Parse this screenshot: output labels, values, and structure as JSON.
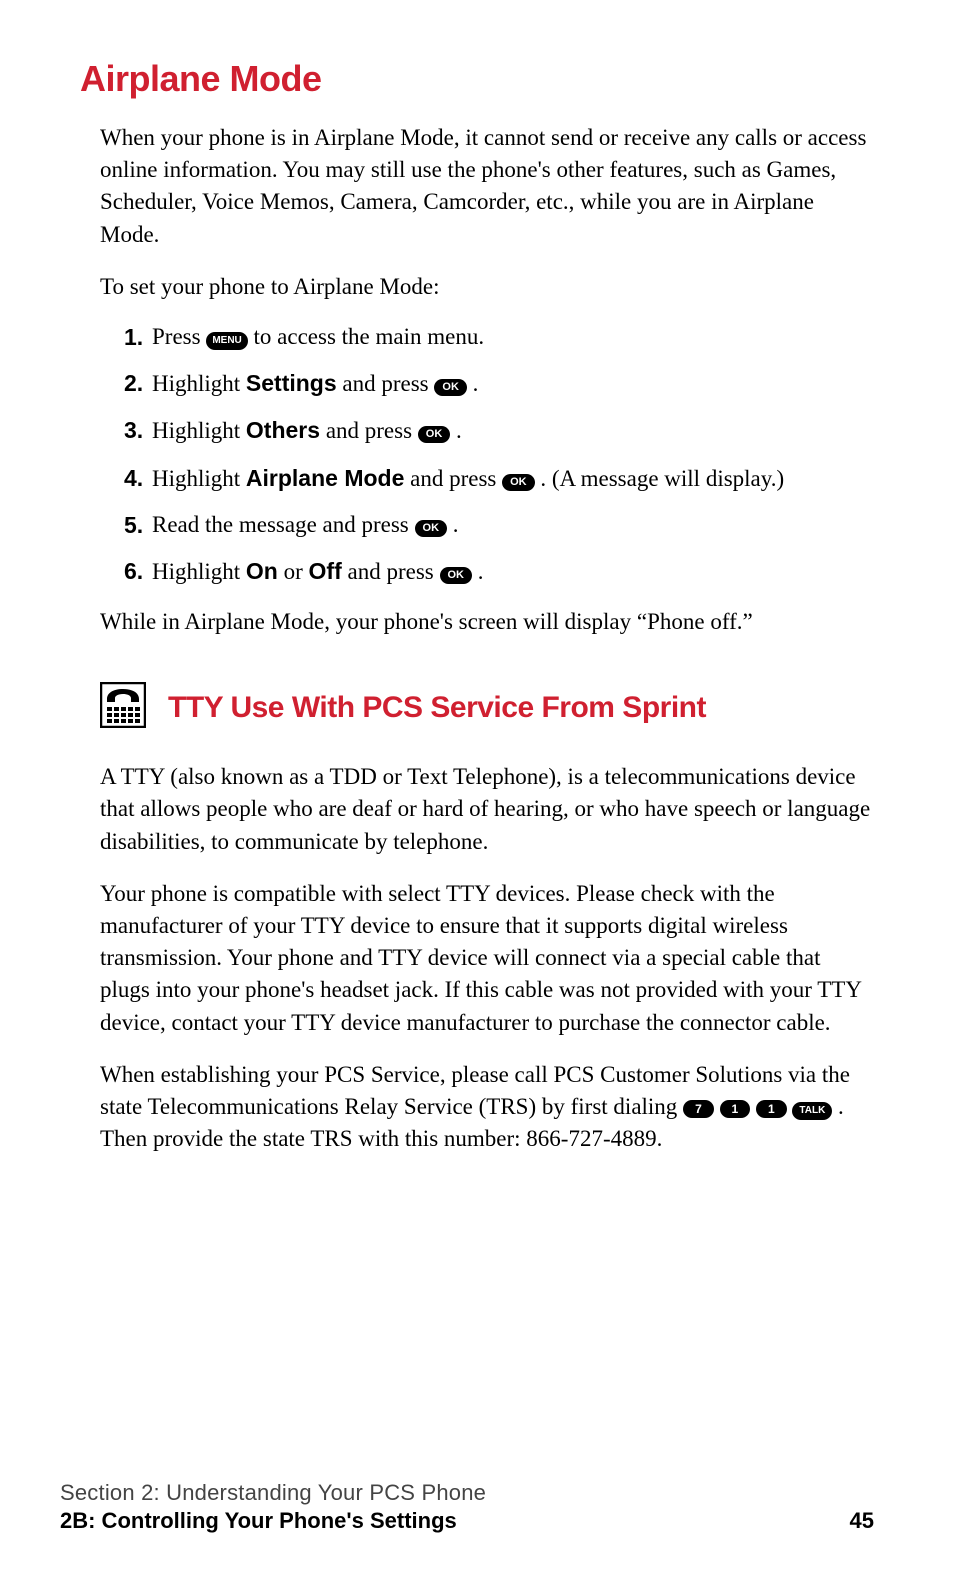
{
  "airplane": {
    "title": "Airplane Mode",
    "para1": "When your phone is in Airplane Mode, it cannot send or receive any calls or access online information. You may still use the phone's other features, such as Games, Scheduler, Voice Memos, Camera, Camcorder, etc., while you are in Airplane Mode.",
    "leadIn": "To set your phone to Airplane Mode:",
    "steps": {
      "n1": "1.",
      "s1a": "Press ",
      "menuKey": "MENU",
      "s1b": " to access the main menu.",
      "n2": "2.",
      "s2a": "Highlight ",
      "s2bold": "Settings",
      "s2b": " and press ",
      "okKey": "OK",
      "period": " .",
      "n3": "3.",
      "s3a": "Highlight ",
      "s3bold": "Others",
      "s3b": " and press ",
      "n4": "4.",
      "s4a": "Highlight ",
      "s4bold": "Airplane Mode",
      "s4b": " and press ",
      "s4c": " . (A message will display.)",
      "n5": "5.",
      "s5a": "Read the message and press ",
      "n6": "6.",
      "s6a": "Highlight ",
      "s6boldOn": "On",
      "s6or": " or ",
      "s6boldOff": "Off",
      "s6b": " and press "
    },
    "after": "While in Airplane Mode, your phone's screen will display “Phone off.”"
  },
  "tty": {
    "title": "TTY Use With PCS Service From Sprint",
    "para1": "A TTY (also known as a TDD or Text Telephone), is a telecommunications device that allows people who are deaf or hard of hearing, or who have speech or language disabilities, to communicate by telephone.",
    "para2": "Your phone is compatible with select TTY devices. Please check with the manufacturer of your TTY device to ensure that it supports digital wireless transmission. Your phone and TTY device will connect via a special cable that plugs into your phone's headset jack. If this cable was not provided with your TTY device, contact your TTY device manufacturer to purchase the connector cable.",
    "para3a": "When establishing your PCS Service, please call PCS Customer Solutions via the state Telecommunications Relay Service (TRS) by first dialing ",
    "key7": "7",
    "key1a": "1",
    "key1b": "1",
    "keyTalk": "TALK",
    "para3b": " . Then provide the state TRS with this number: 866-727-4889."
  },
  "footer": {
    "line1": "Section 2: Understanding Your PCS Phone",
    "line2": "2B: Controlling Your Phone's Settings",
    "pageNum": "45"
  }
}
